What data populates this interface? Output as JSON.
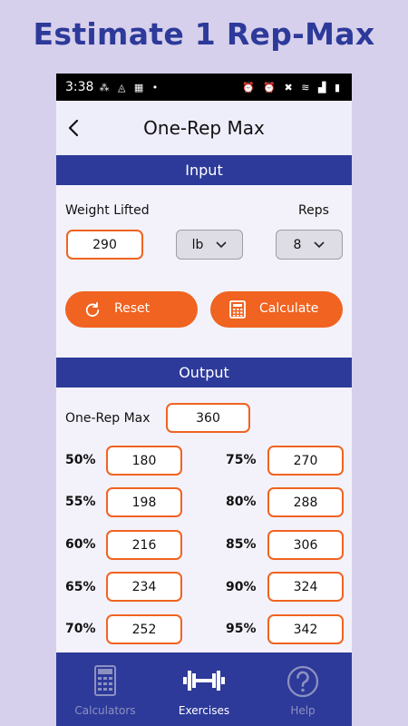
{
  "promo": {
    "title": "Estimate 1 Rep-Max"
  },
  "status_bar": {
    "time": "3:38",
    "left_icons": "⁂ ◬ ▦ •",
    "right_icons": "⏰ ⏰ ✖ ≋ ▟ ▮"
  },
  "header": {
    "title": "One-Rep Max",
    "back_icon": "chevron-left-icon"
  },
  "input": {
    "section_title": "Input",
    "weight_label": "Weight Lifted",
    "weight_value": "290",
    "unit_value": "lb",
    "reps_label": "Reps",
    "reps_value": "8",
    "reset_label": "Reset",
    "calculate_label": "Calculate"
  },
  "output": {
    "section_title": "Output",
    "one_rep_max_label": "One-Rep Max",
    "one_rep_max_value": "360",
    "percentages": [
      {
        "label": "50%",
        "value": "180"
      },
      {
        "label": "55%",
        "value": "198"
      },
      {
        "label": "60%",
        "value": "216"
      },
      {
        "label": "65%",
        "value": "234"
      },
      {
        "label": "70%",
        "value": "252"
      },
      {
        "label": "75%",
        "value": "270"
      },
      {
        "label": "80%",
        "value": "288"
      },
      {
        "label": "85%",
        "value": "306"
      },
      {
        "label": "90%",
        "value": "324"
      },
      {
        "label": "95%",
        "value": "342"
      }
    ]
  },
  "nav": {
    "items": [
      {
        "label": "Calculators",
        "icon": "calculator-icon",
        "active": false
      },
      {
        "label": "Exercises",
        "icon": "dumbbell-icon",
        "active": true
      },
      {
        "label": "Help",
        "icon": "help-icon",
        "active": false
      }
    ]
  },
  "colors": {
    "primary": "#2d3a9a",
    "accent": "#f06320",
    "background": "#d7d0ec",
    "surface": "#f3f2fb"
  }
}
